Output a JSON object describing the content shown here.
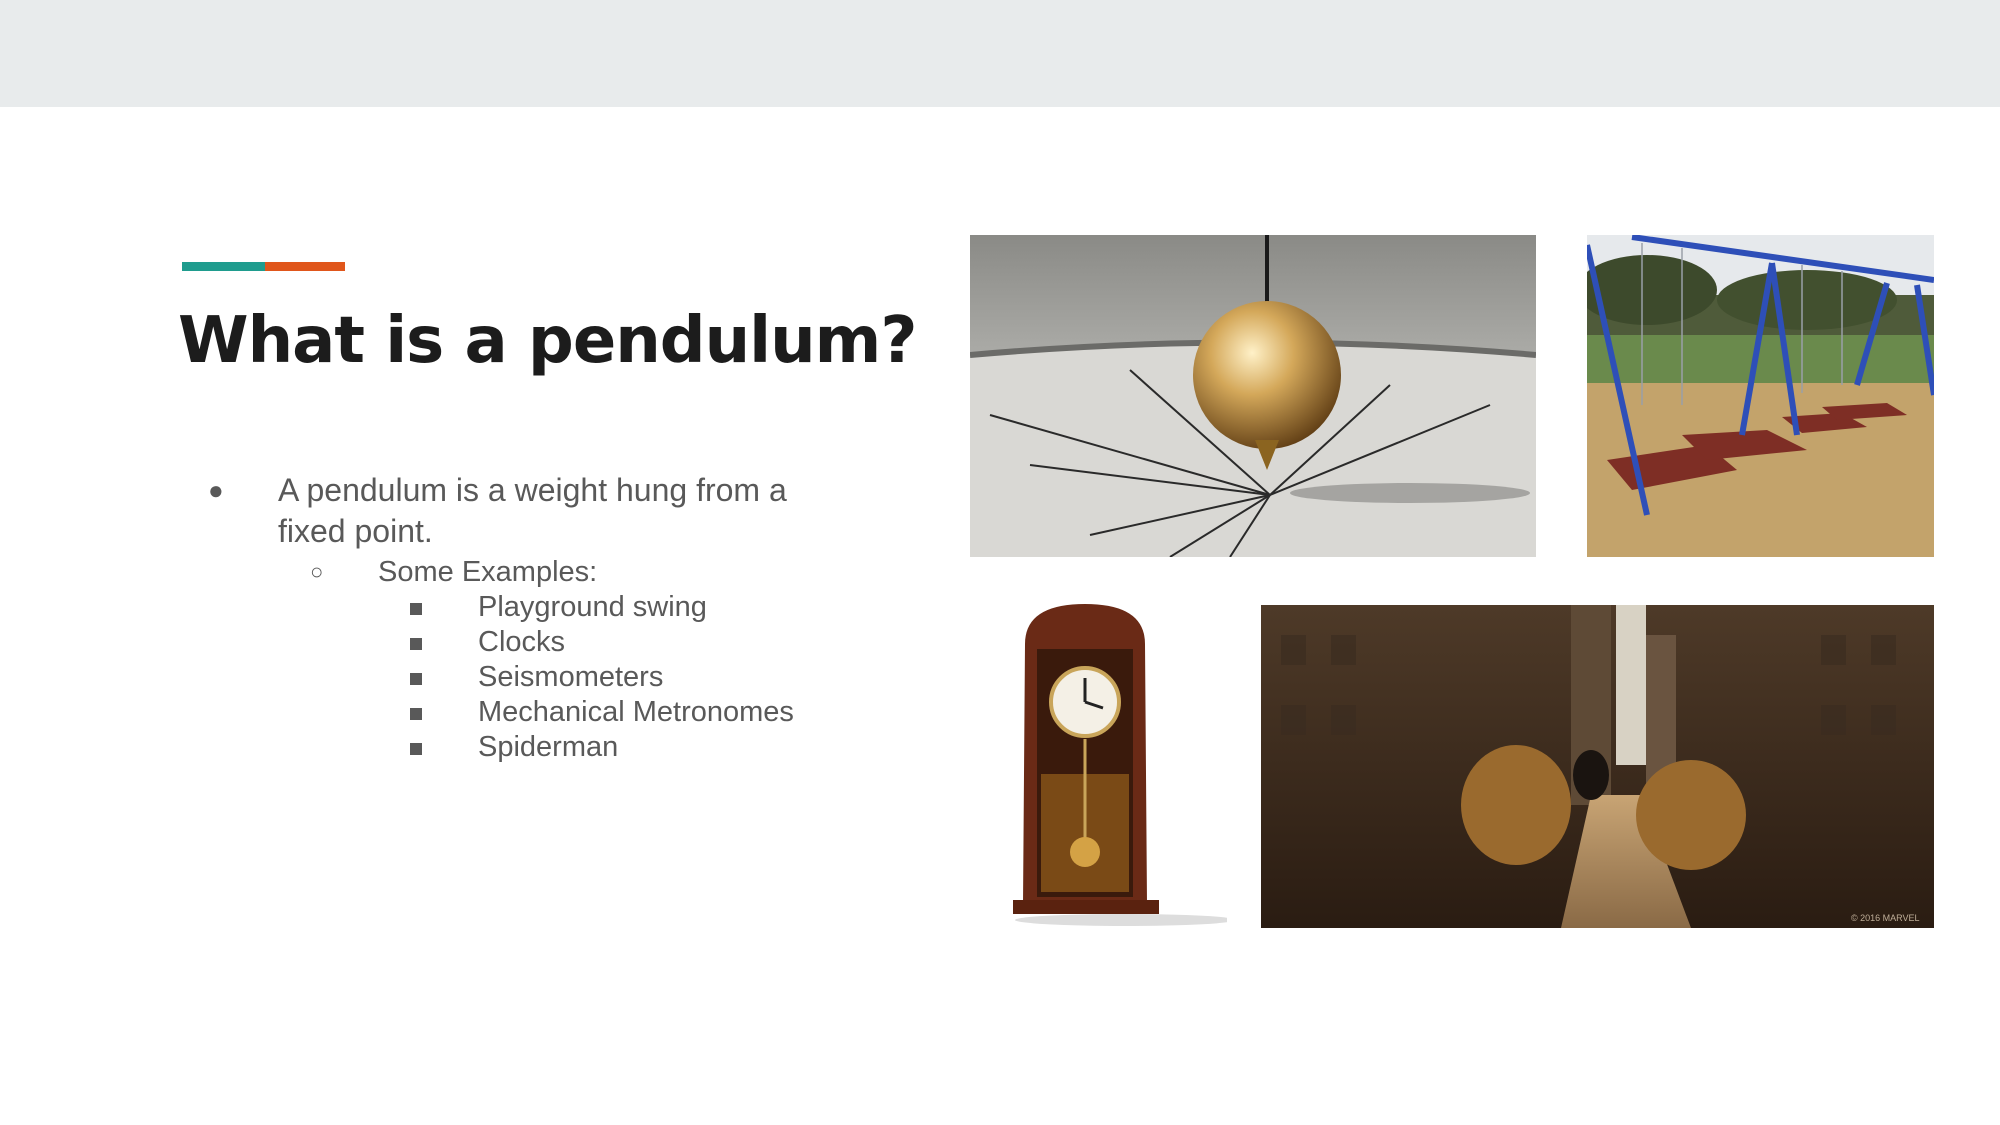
{
  "slide": {
    "title": "What is a pendulum?",
    "accent_colors": [
      "#1f9c8e",
      "#e0561b"
    ],
    "bullets": {
      "level1_marker": "●",
      "level1_text": "A pendulum is a weight hung from a fixed point.",
      "level2_marker": "○",
      "level2_text": "Some Examples:",
      "level3_items": [
        "Playground swing",
        "Clocks",
        "Seismometers",
        "Mechanical Metronomes",
        "Spiderman"
      ]
    },
    "photos": {
      "city_caption": "© 2016 MARVEL"
    }
  }
}
